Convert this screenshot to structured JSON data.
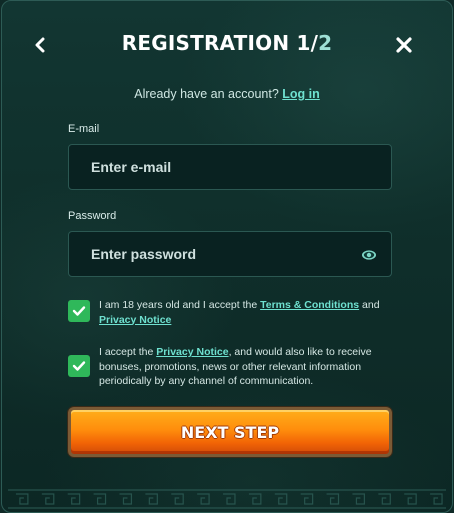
{
  "header": {
    "title": "REGISTRATION 1/",
    "title_step_total": "2"
  },
  "account": {
    "prompt": "Already have an account?",
    "login_link": "Log in"
  },
  "email": {
    "label": "E-mail",
    "placeholder": "Enter e-mail",
    "value": ""
  },
  "password": {
    "label": "Password",
    "placeholder": "Enter password",
    "value": ""
  },
  "consents": [
    {
      "checked": true,
      "text_1": "I am 18 years old and I accept the ",
      "link_1": "Terms & Conditions",
      "text_2": " and ",
      "link_2": "Privacy Notice",
      "text_3": ""
    },
    {
      "checked": true,
      "text_1": "I accept the ",
      "link_1": "Privacy Notice",
      "text_2": ", and would also like to receive bonuses, promotions, news or other relevant information periodically by any channel of communication.",
      "link_2": "",
      "text_3": ""
    }
  ],
  "next_button": {
    "label": "NEXT STEP"
  },
  "icons": {
    "back": "chevron-left-icon",
    "close": "close-icon",
    "eye": "eye-icon",
    "check": "check-icon"
  },
  "colors": {
    "background": "#0f2e2a",
    "accent_link": "#6fe1d0",
    "checkbox_green": "#2fb85a",
    "button_orange": "#ff8d0c",
    "input_bg": "#092221"
  }
}
